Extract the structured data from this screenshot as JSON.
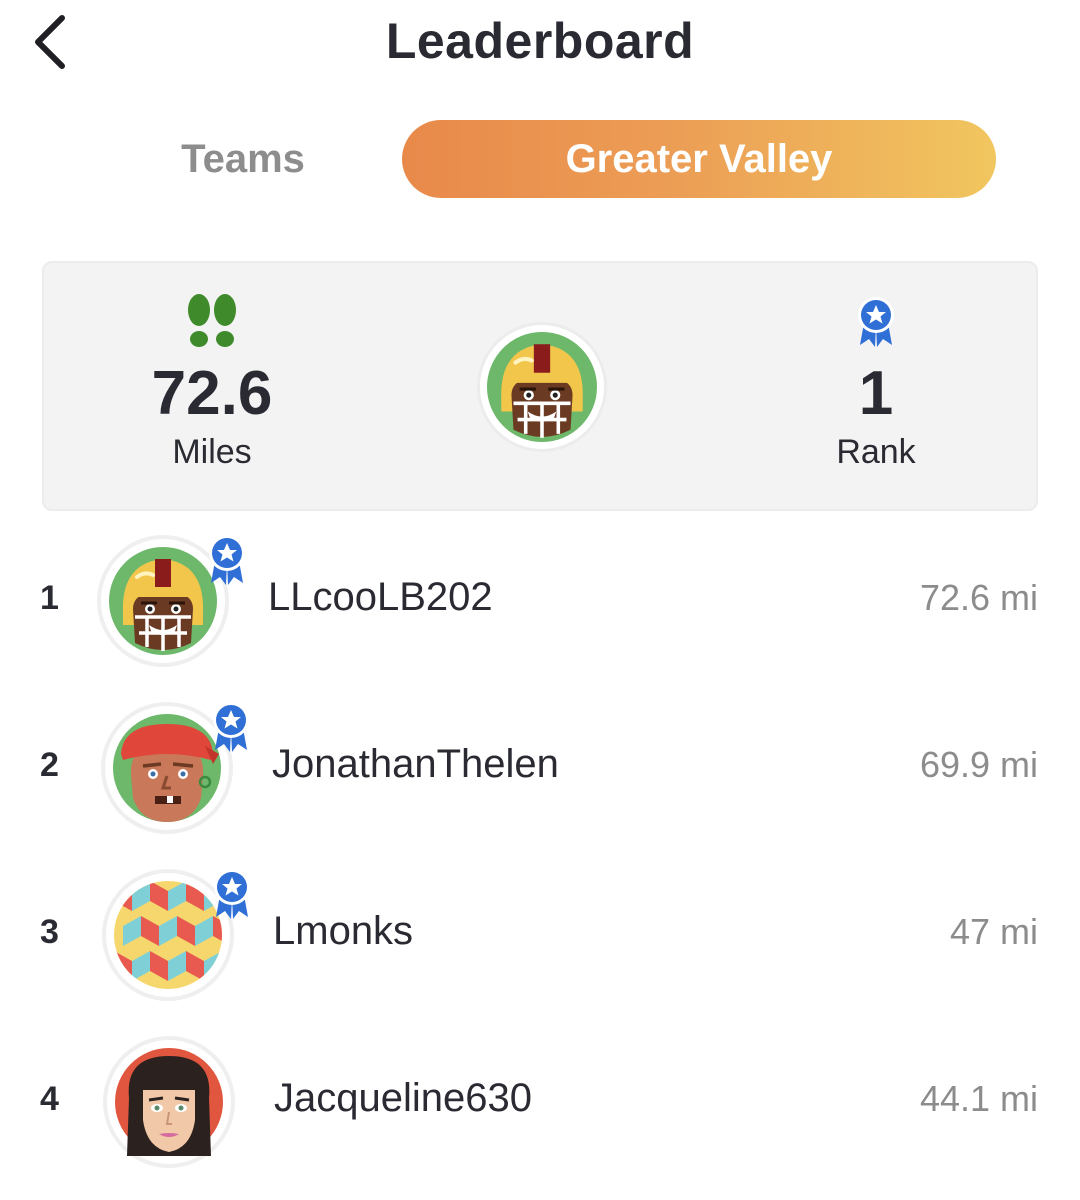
{
  "header": {
    "title": "Leaderboard",
    "back_icon": "chevron-left-icon"
  },
  "tabs": [
    {
      "label": "Teams",
      "active": false
    },
    {
      "label": "Greater Valley",
      "active": true
    }
  ],
  "colors": {
    "accent_start": "#e8894a",
    "accent_end": "#f1c65f",
    "badge_blue": "#2f6fd6",
    "feet_green": "#3f8a2a"
  },
  "summary": {
    "miles_value": "72.6",
    "miles_label": "Miles",
    "miles_icon": "footprints-icon",
    "rank_value": "1",
    "rank_label": "Rank",
    "rank_icon": "ribbon-badge-icon",
    "avatar": "football-player-avatar"
  },
  "leaderboard": [
    {
      "rank": "1",
      "name": "LLcooLB202",
      "distance": "72.6 mi",
      "avatar": "football-player-avatar",
      "badge": true
    },
    {
      "rank": "2",
      "name": "JonathanThelen",
      "distance": "69.9 mi",
      "avatar": "pirate-avatar",
      "badge": true
    },
    {
      "rank": "3",
      "name": "Lmonks",
      "distance": "47 mi",
      "avatar": "cube-pattern-avatar",
      "badge": true
    },
    {
      "rank": "4",
      "name": "Jacqueline630",
      "distance": "44.1 mi",
      "avatar": "woman-avatar",
      "badge": false
    }
  ]
}
